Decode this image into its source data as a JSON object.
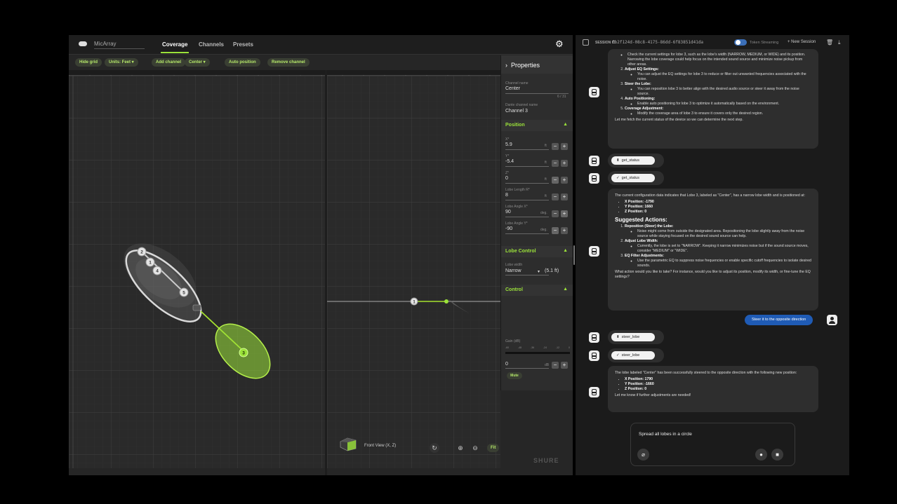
{
  "app": {
    "name": "MicArray",
    "tabs": [
      "Coverage",
      "Channels",
      "Presets"
    ],
    "active_tab": "Coverage",
    "toolbar": {
      "hide_grid": "Hide grid",
      "units": "Units: Feet",
      "add_channel": "Add channel",
      "center": "Center",
      "auto_position": "Auto position",
      "remove_channel": "Remove channel"
    },
    "lobes": [
      {
        "label": "2"
      },
      {
        "label": "1"
      },
      {
        "label": "4"
      },
      {
        "label": "5"
      },
      {
        "label": "3"
      }
    ],
    "front_view_label": "Front View (X, Z)",
    "fit_label": "Fit",
    "brand": "SHURE",
    "colors": {
      "accent": "#9be23a",
      "panel": "#262626"
    }
  },
  "properties": {
    "title": "Properties",
    "channel_name_label": "Channel name",
    "channel_name_value": "Center",
    "channel_name_count": "6 / 31",
    "dante_label": "Dante channel name",
    "dante_value": "Channel 3",
    "position_header": "Position",
    "x_label": "X*",
    "x_value": "5.9",
    "y_label": "Y*",
    "y_value": "-5.4",
    "z_label": "Z*",
    "z_value": "0",
    "lobe_length_label": "Lobe Length R*",
    "lobe_length_value": "8",
    "angle_x_label": "Lobe Angle X*",
    "angle_x_value": "90",
    "angle_y_label": "Lobe Angle Y*",
    "angle_y_value": "-90",
    "unit_ft": "ft",
    "unit_deg": "deg.",
    "lobe_control_header": "Lobe Control",
    "lobe_width_label": "Lobe width",
    "lobe_width_value": "Narrow",
    "lobe_width_extra": "(5.1 ft)",
    "control_header": "Control",
    "gain_label": "Gain (dB)",
    "gain_ticks": [
      "-60",
      "-48",
      "-36",
      "-24",
      "-12",
      "0"
    ],
    "gain_value": "0",
    "gain_unit": "dB",
    "mute_label": "Mute"
  },
  "chat": {
    "session_label": "SESSION ID",
    "session_id": "fb2f124d-08c8-4175-86dd-6f83851d41da",
    "token_streaming": "Token Streaming",
    "new_session": "+ New Session",
    "msg1": {
      "top_fragment": "Check the current settings for lobe 3, such as the lobe's width (NARROW, MEDIUM, or WIDE) and its position. Narrowing the lobe coverage could help focus on the intended sound source and minimize noise pickup from other areas.",
      "item2_title": "Adjust EQ Settings:",
      "item2_text": "You can adjust the EQ settings for lobe 3 to reduce or filter out unwanted frequencies associated with the noise.",
      "item3_title": "Steer the Lobe:",
      "item3_text": "You can reposition lobe 3 to better align with the desired audio source or steer it away from the noise source.",
      "item4_title": "Auto Positioning:",
      "item4_text": "Enable auto positioning for lobe 3 to optimize it automatically based on the environment.",
      "item5_title": "Coverage Adjustment:",
      "item5_text": "Modify the coverage area of lobe 3 to ensure it covers only the desired region.",
      "closing": "Let me fetch the current status of the device so we can determine the next step."
    },
    "tool1_call": "get_status",
    "tool1_done": "get_status",
    "msg2": {
      "intro": "The current configuration data indicates that Lobe 3, labeled as \"Center\", has a narrow lobe width and is positioned at:",
      "x": "X Position: -1790",
      "y": "Y Position: 1660",
      "z": "Z Position: 0",
      "heading": "Suggested Actions:",
      "a1_title": "Reposition (Steer) the Lobe:",
      "a1_text": "Noise might come from outside the designated area. Repositioning the lobe slightly away from the noise source while staying focused on the desired sound source can help.",
      "a2_title": "Adjust Lobe Width:",
      "a2_text": "Currently, the lobe is set to \"NARROW\". Keeping it narrow minimizes noise but if the sound source moves, consider \"MEDIUM\" or \"WIDE\".",
      "a3_title": "EQ Filter Adjustments:",
      "a3_text": "Use the parametric EQ to suppress noise frequencies or enable specific cutoff frequencies to isolate desired sounds.",
      "closing": "What action would you like to take? For instance, would you like to adjust its position, modify its width, or fine-tune the EQ settings?"
    },
    "user_msg": "Steer it to the opposite direction",
    "tool2_call": "steer_lobe",
    "tool2_done": "steer_lobe",
    "msg3": {
      "intro": "The lobe labeled \"Center\" has been successfully steered to the opposite direction with the following new position:",
      "x": "X Position: 1790",
      "y": "Y Position: -1660",
      "z": "Z Position: 0",
      "closing": "Let me know if further adjustments are needed!"
    },
    "composer_text": "Spread all lobes in a circle"
  }
}
